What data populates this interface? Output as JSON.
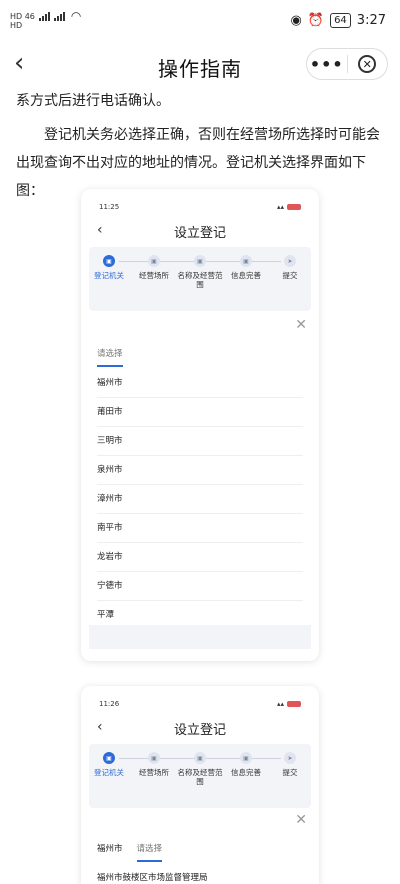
{
  "status_bar": {
    "left_top": "HD 46",
    "left_bottom": "HD",
    "battery": "64",
    "time": "3:27"
  },
  "nav": {
    "title": "操作指南",
    "more": "•••"
  },
  "article": {
    "line1": "系方式后进行电话确认。",
    "para2": "登记机关务必选择正确，否则在经营场所选择时可能会出现查询不出对应的地址的情况。登记机关选择界面如下图："
  },
  "shot1": {
    "time": "11:25",
    "title": "设立登记",
    "steps": [
      {
        "label": "登记机关",
        "active": true
      },
      {
        "label": "经营场所",
        "active": false
      },
      {
        "label": "名称及经营范围",
        "active": false
      },
      {
        "label": "信息完善",
        "active": false
      },
      {
        "label": "提交",
        "active": false
      }
    ],
    "tab_label": "请选择",
    "cities": [
      "福州市",
      "莆田市",
      "三明市",
      "泉州市",
      "漳州市",
      "南平市",
      "龙岩市",
      "宁德市",
      "平潭"
    ]
  },
  "shot2": {
    "time": "11:26",
    "title": "设立登记",
    "steps": [
      {
        "label": "登记机关",
        "active": true
      },
      {
        "label": "经营场所",
        "active": false
      },
      {
        "label": "名称及经营范围",
        "active": false
      },
      {
        "label": "信息完善",
        "active": false
      },
      {
        "label": "提交",
        "active": false
      }
    ],
    "tab_selected": "福州市",
    "tab_label": "请选择",
    "first_item": "福州市鼓楼区市场监督管理局"
  }
}
